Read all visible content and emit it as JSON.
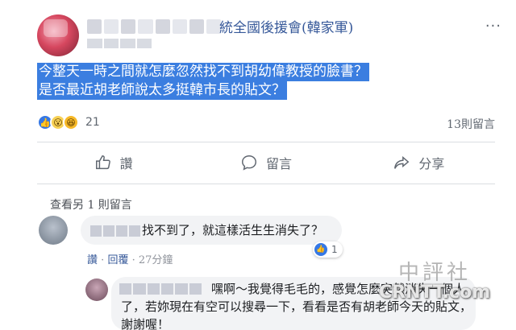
{
  "post": {
    "group_name": "統全國後援會(韓家軍)",
    "more_icon": "more-dots-icon",
    "body_lines": [
      "今整天一時之間就怎麼忽然找不到胡幼偉教授的臉書？",
      "是否最近胡老師說太多挺韓市長的貼文？"
    ],
    "reaction_count": "21",
    "reaction_icons": [
      "like-reaction-icon",
      "wow-reaction-icon",
      "haha-reaction-icon"
    ],
    "comment_count": "13則留言"
  },
  "actions": {
    "like": "讚",
    "comment": "留言",
    "share": "分享"
  },
  "comments": {
    "view_more": "查看另 1 則留言",
    "first": {
      "text": "找不到了，就這樣活生生消失了？",
      "reaction_count": "1",
      "like_link": "讚",
      "separator": "·",
      "reply_link": "回覆",
      "time": "27分鐘"
    },
    "reply": {
      "text": "嘿啊～我覺得毛毛的，感覺怎麼突然消失一個人了，若妳現在有空可以搜尋一下，看看是否有胡老師今天的貼文，謝謝喔！"
    }
  },
  "watermark": {
    "cn": "中評社",
    "en": "CRNTT.com"
  },
  "colors": {
    "selection": "#3b7ee0",
    "link": "#365899",
    "muted": "#606770",
    "bubble": "#f2f3f5"
  }
}
